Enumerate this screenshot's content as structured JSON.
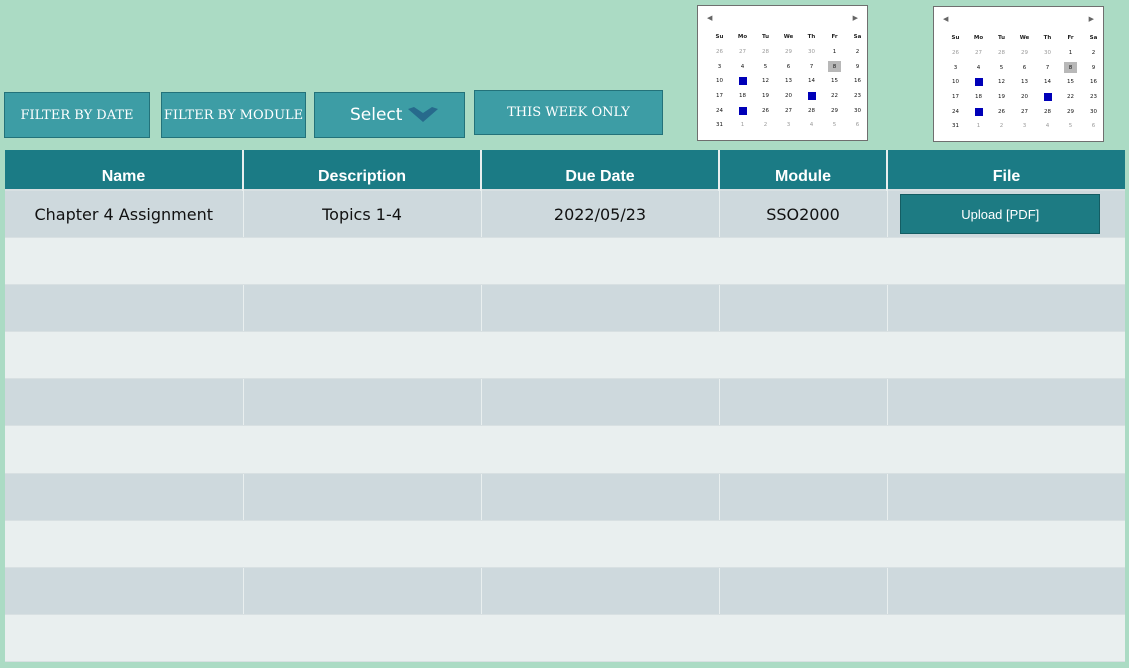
{
  "filters": {
    "by_date": "FILTER BY DATE",
    "by_module": "FILTER BY MODULE",
    "select": "Select",
    "this_week": "THIS WEEK ONLY"
  },
  "calendars": [
    {
      "weekdays": [
        "Su",
        "Mo",
        "Tu",
        "We",
        "Th",
        "Fr",
        "Sa"
      ],
      "weeks": [
        [
          "26",
          "27",
          "28",
          "29",
          "30",
          "1",
          "2"
        ],
        [
          "3",
          "4",
          "5",
          "6",
          "7",
          "8",
          "9"
        ],
        [
          "10",
          "11",
          "12",
          "13",
          "14",
          "15",
          "16"
        ],
        [
          "17",
          "18",
          "19",
          "20",
          "21",
          "22",
          "23"
        ],
        [
          "24",
          "25",
          "26",
          "27",
          "28",
          "29",
          "30"
        ],
        [
          "31",
          "1",
          "2",
          "3",
          "4",
          "5",
          "6"
        ]
      ],
      "today": "8",
      "highlighted_days": [
        "11",
        "21",
        "25"
      ]
    },
    {
      "weekdays": [
        "Su",
        "Mo",
        "Tu",
        "We",
        "Th",
        "Fr",
        "Sa"
      ],
      "weeks": [
        [
          "26",
          "27",
          "28",
          "29",
          "30",
          "1",
          "2"
        ],
        [
          "3",
          "4",
          "5",
          "6",
          "7",
          "8",
          "9"
        ],
        [
          "10",
          "11",
          "12",
          "13",
          "14",
          "15",
          "16"
        ],
        [
          "17",
          "18",
          "19",
          "20",
          "21",
          "22",
          "23"
        ],
        [
          "24",
          "25",
          "26",
          "27",
          "28",
          "29",
          "30"
        ],
        [
          "31",
          "1",
          "2",
          "3",
          "4",
          "5",
          "6"
        ]
      ],
      "today": "8",
      "highlighted_days": [
        "11",
        "21",
        "25"
      ]
    }
  ],
  "table": {
    "columns": [
      "Name",
      "Description",
      "Due Date",
      "Module",
      "File"
    ],
    "rows": [
      {
        "name": "Chapter 4 Assignment",
        "description": "Topics 1-4",
        "due_date": "2022/05/23",
        "module": "SSO2000",
        "file_button": "Upload [PDF]"
      }
    ],
    "empty_row_count": 9
  },
  "colors": {
    "background": "#abdbc4",
    "header": "#1b7b85",
    "button": "#3d9da5",
    "row_light": "#e9efef",
    "row_dark": "#ced9dd",
    "calendar_mark": "#0000b8"
  },
  "icons": {
    "select_chevron": "chevron-down-icon",
    "calendar_prev": "triangle-left-icon",
    "calendar_next": "triangle-right-icon"
  }
}
